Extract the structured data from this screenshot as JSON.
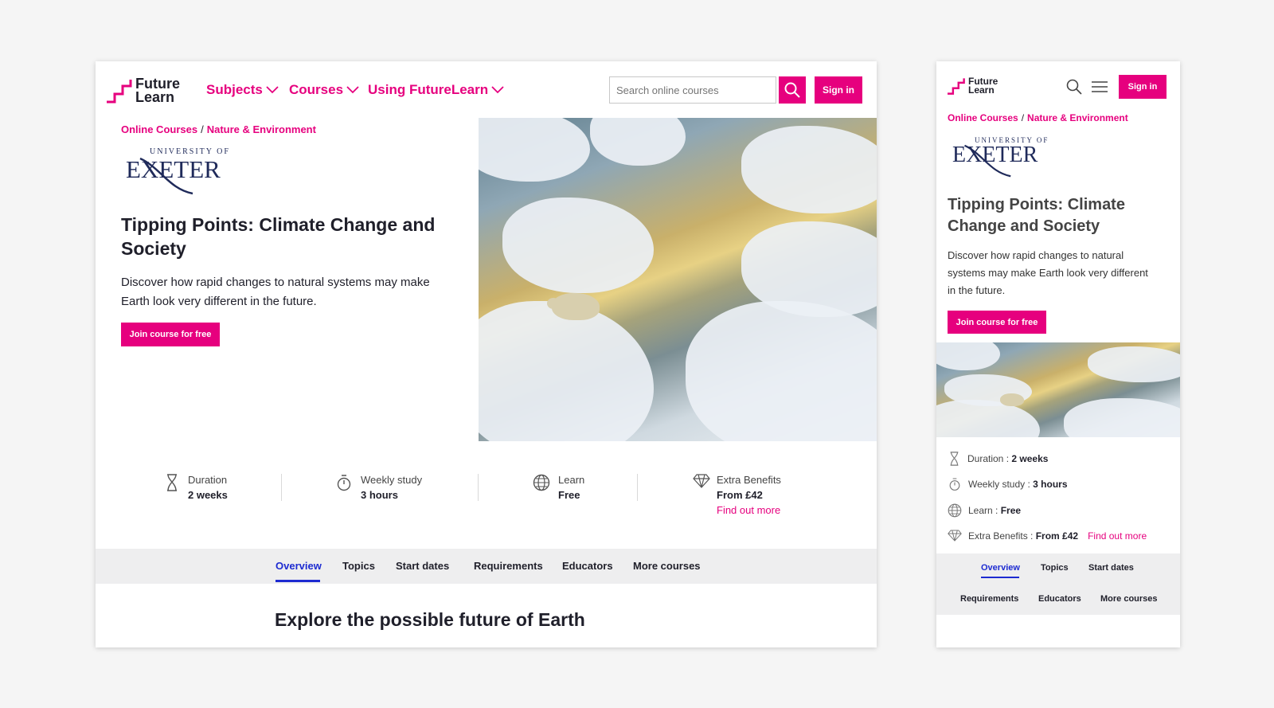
{
  "brand": {
    "line1": "Future",
    "line2": "Learn",
    "accent": "#e6007e"
  },
  "nav": {
    "subjects": "Subjects",
    "courses": "Courses",
    "using": "Using FutureLearn"
  },
  "search": {
    "placeholder": "Search online courses"
  },
  "signin": "Sign in",
  "breadcrumb": {
    "first": "Online Courses",
    "sep": "/",
    "second": "Nature & Environment"
  },
  "university": {
    "small": "UNIVERSITY OF",
    "big": "EXETER"
  },
  "course": {
    "title": "Tipping Points: Climate Change and Society",
    "description": "Discover how rapid changes to natural systems may make Earth look very different in the future.",
    "join": "Join course for free"
  },
  "stats": {
    "duration": {
      "label": "Duration",
      "value": "2 weeks"
    },
    "weekly": {
      "label": "Weekly study",
      "value": "3 hours"
    },
    "learn": {
      "label": "Learn",
      "value": "Free"
    },
    "extra": {
      "label": "Extra Benefits",
      "value": "From £42",
      "link": "Find out more"
    }
  },
  "tabs": [
    "Overview",
    "Topics",
    "Start dates",
    "Requirements",
    "Educators",
    "More courses"
  ],
  "section_heading": "Explore the possible future of Earth",
  "mobile": {
    "colon": " : "
  },
  "colors": {
    "accent": "#e6007e",
    "active_tab": "#1d2bd1",
    "tab_bg": "#eeeeef"
  },
  "icons": [
    "hourglass-icon",
    "stopwatch-icon",
    "globe-icon",
    "diamond-icon",
    "search-icon",
    "menu-icon",
    "chevron-down-icon",
    "futurelearn-logo-icon"
  ]
}
